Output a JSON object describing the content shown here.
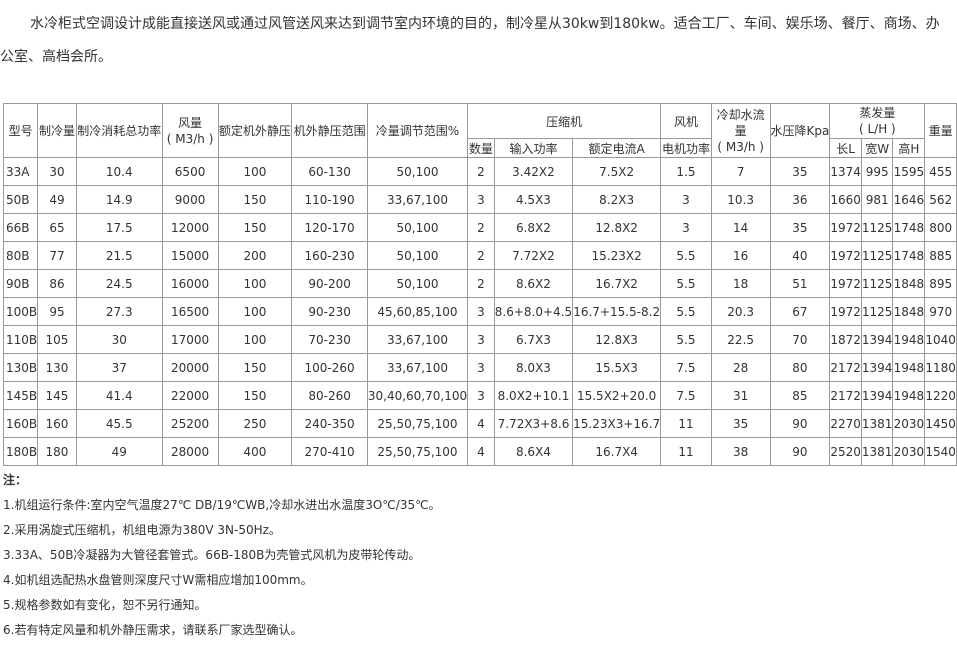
{
  "intro": "水冷柜式空调设计成能直接送风或通过风管送风来达到调节室内环境的目的，制冷星从30kw到180kw。适合工厂、车间、娱乐场、餐厅、商场、办公室、高档会所。",
  "table": {
    "headers": {
      "model": "型号",
      "cooling": "制冷量",
      "power_total": "制冷消耗总功率",
      "airflow": "风量",
      "airflow_unit": "( M3/h )",
      "static_rated": "额定机外静压",
      "static_range": "机外静压范围",
      "cooling_range": "冷量调节范围%",
      "compressor": "压缩机",
      "comp_qty": "数量",
      "comp_power": "输入功率",
      "comp_current": "额定电流A",
      "fan": "风机",
      "fan_power": "电机功率",
      "water_flow": "冷却水流量",
      "water_flow_unit": "( M3/h )",
      "pressure_drop": "水压降Kpa",
      "evaporator": "蒸发量",
      "evaporator_unit": "( L/H )",
      "len": "长L",
      "wid": "宽W",
      "hei": "高H",
      "weight": "重量"
    },
    "rows": [
      [
        "33A",
        "30",
        "10.4",
        "6500",
        "100",
        "60-130",
        "50,100",
        "2",
        "3.42X2",
        "7.5X2",
        "1.5",
        "7",
        "35",
        "1374",
        "995",
        "1595",
        "455"
      ],
      [
        "50B",
        "49",
        "14.9",
        "9000",
        "150",
        "110-190",
        "33,67,100",
        "3",
        "4.5X3",
        "8.2X3",
        "3",
        "10.3",
        "36",
        "1660",
        "981",
        "1646",
        "562"
      ],
      [
        "66B",
        "65",
        "17.5",
        "12000",
        "150",
        "120-170",
        "50,100",
        "2",
        "6.8X2",
        "12.8X2",
        "3",
        "14",
        "35",
        "1972",
        "1125",
        "1748",
        "800"
      ],
      [
        "80B",
        "77",
        "21.5",
        "15000",
        "200",
        "160-230",
        "50,100",
        "2",
        "7.72X2",
        "15.23X2",
        "5.5",
        "16",
        "40",
        "1972",
        "1125",
        "1748",
        "885"
      ],
      [
        "90B",
        "86",
        "24.5",
        "16000",
        "100",
        "90-200",
        "50,100",
        "2",
        "8.6X2",
        "16.7X2",
        "5.5",
        "18",
        "51",
        "1972",
        "1125",
        "1848",
        "895"
      ],
      [
        "100B",
        "95",
        "27.3",
        "16500",
        "100",
        "90-230",
        "45,60,85,100",
        "3",
        "8.6+8.0+4.5",
        "16.7+15.5-8.2",
        "5.5",
        "20.3",
        "67",
        "1972",
        "1125",
        "1848",
        "970"
      ],
      [
        "110B",
        "105",
        "30",
        "17000",
        "100",
        "70-230",
        "33,67,100",
        "3",
        "6.7X3",
        "12.8X3",
        "5.5",
        "22.5",
        "70",
        "1872",
        "1394",
        "1948",
        "1040"
      ],
      [
        "130B",
        "130",
        "37",
        "20000",
        "150",
        "100-260",
        "33,67,100",
        "3",
        "8.0X3",
        "15.5X3",
        "7.5",
        "28",
        "80",
        "2172",
        "1394",
        "1948",
        "1180"
      ],
      [
        "145B",
        "145",
        "41.4",
        "22000",
        "150",
        "80-260",
        "30,40,60,70,100",
        "3",
        "8.0X2+10.1",
        "15.5X2+20.0",
        "7.5",
        "31",
        "85",
        "2172",
        "1394",
        "1948",
        "1220"
      ],
      [
        "160B",
        "160",
        "45.5",
        "25200",
        "250",
        "240-350",
        "25,50,75,100",
        "4",
        "7.72X3+8.6",
        "15.23X3+16.7",
        "11",
        "35",
        "90",
        "2270",
        "1381",
        "2030",
        "1450"
      ],
      [
        "180B",
        "180",
        "49",
        "28000",
        "400",
        "270-410",
        "25,50,75,100",
        "4",
        "8.6X4",
        "16.7X4",
        "11",
        "38",
        "90",
        "2520",
        "1381",
        "2030",
        "1540"
      ]
    ]
  },
  "notes": {
    "header": "注：",
    "items": [
      "1.机组运行条件:室内空气温度27℃ DB/19℃WB,冷却水进出水温度3O℃/35℃。",
      "2.采用涡旋式压缩机，机组电源为380V 3N-50Hz。",
      "3.33A、50B冷凝器为大管径套管式。66B-180B为壳管式风机为皮带轮传动。",
      "4.如机组选配热水盘管则深度尺寸W需相应增加100mm。",
      "5.规格参数如有变化，恕不另行通知。",
      "6.若有特定风量和机外静压需求，请联系厂家选型确认。"
    ]
  }
}
